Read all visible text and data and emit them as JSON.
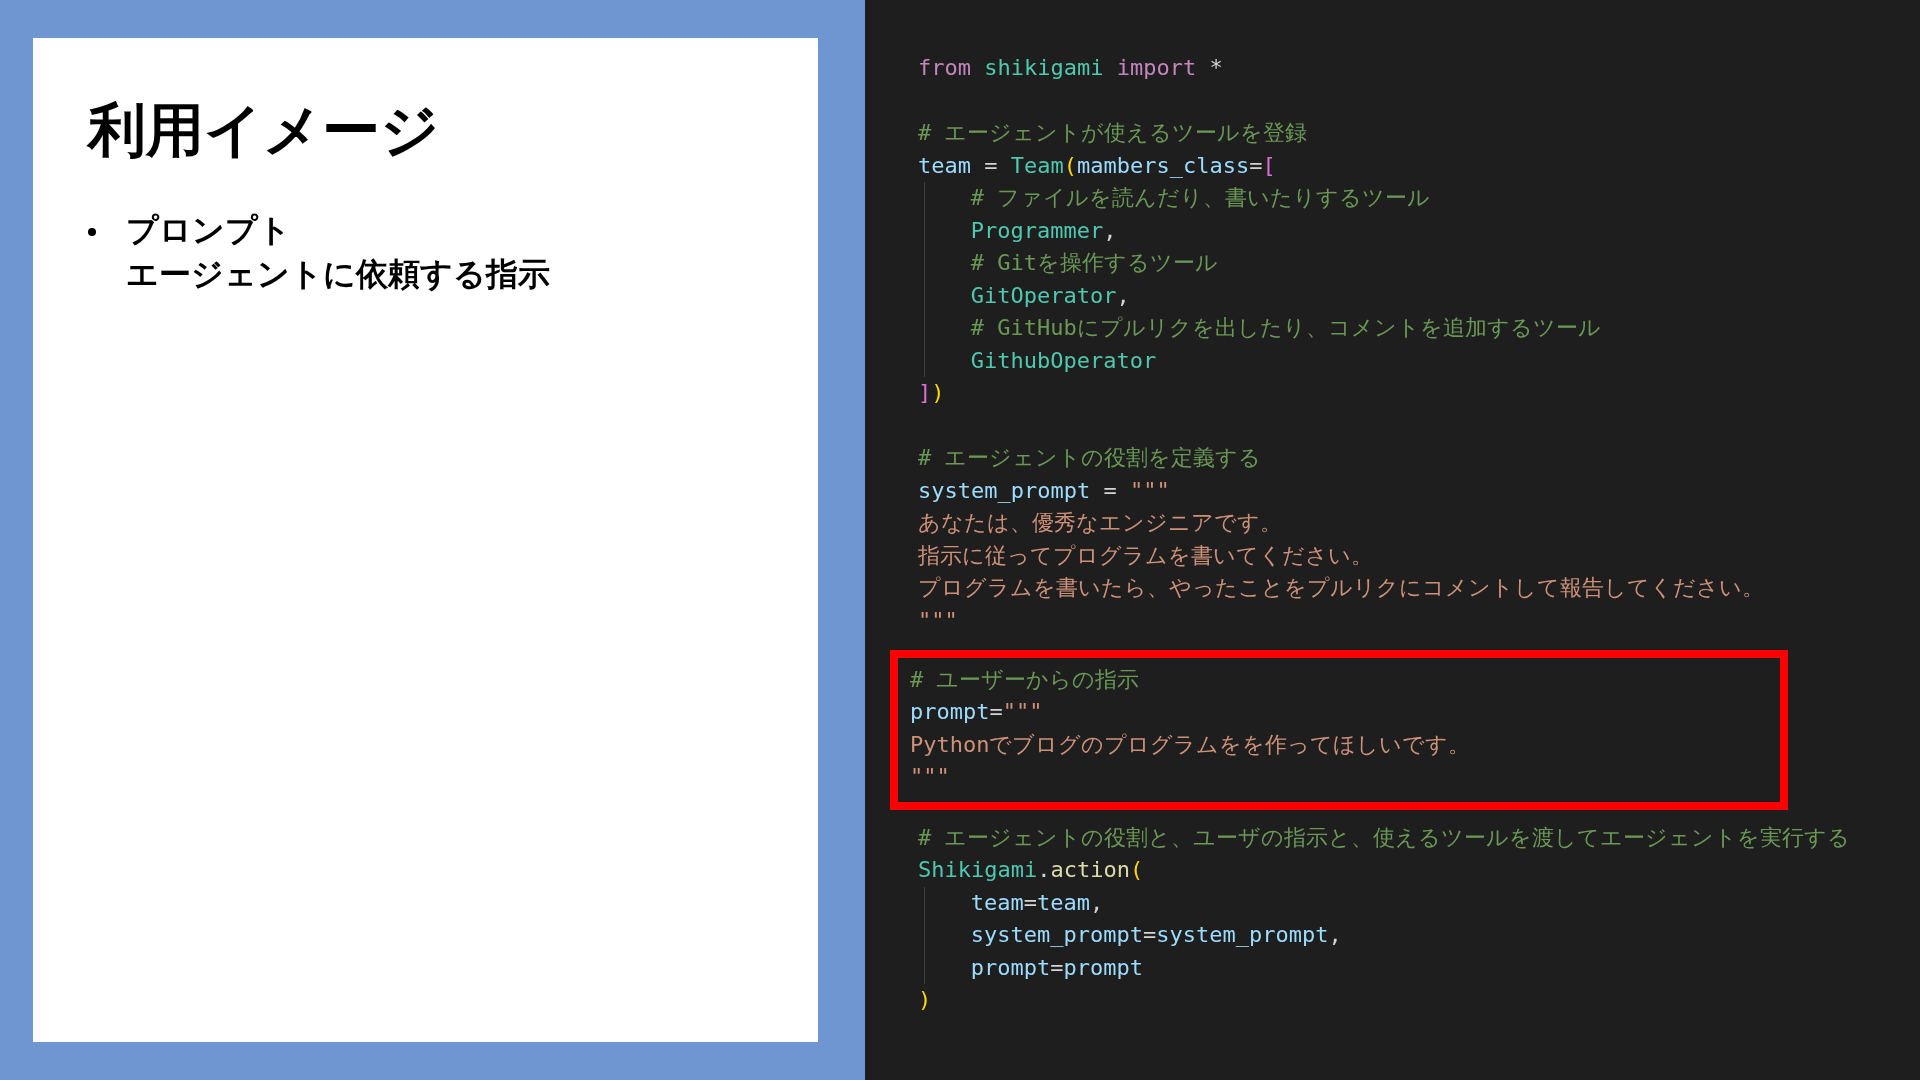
{
  "slide": {
    "title": "利用イメージ",
    "bullets": [
      {
        "lines": [
          "プロンプト",
          "エージェントに依頼する指示"
        ]
      }
    ]
  },
  "code": {
    "blocks": [
      {
        "highlighted": false,
        "lines": [
          {
            "indent": false,
            "tokens": [
              {
                "text": "from",
                "kind": "keyword"
              },
              {
                "text": " shikigami ",
                "kind": "module"
              },
              {
                "text": "import",
                "kind": "keyword"
              },
              {
                "text": " *",
                "kind": "plain"
              }
            ]
          }
        ]
      },
      {
        "highlighted": false,
        "lines": [
          {
            "indent": false,
            "tokens": [
              {
                "text": "# エージェントが使えるツールを登録",
                "kind": "comment"
              }
            ]
          },
          {
            "indent": false,
            "tokens": [
              {
                "text": "team",
                "kind": "variable"
              },
              {
                "text": " = ",
                "kind": "plain"
              },
              {
                "text": "Team",
                "kind": "class"
              },
              {
                "text": "(",
                "kind": "bracket-gold"
              },
              {
                "text": "mambers_class",
                "kind": "variable"
              },
              {
                "text": "=",
                "kind": "plain"
              },
              {
                "text": "[",
                "kind": "bracket-pink"
              }
            ]
          },
          {
            "indent": true,
            "tokens": [
              {
                "text": "# ファイルを読んだり、書いたりするツール",
                "kind": "comment"
              }
            ]
          },
          {
            "indent": true,
            "tokens": [
              {
                "text": "Programmer",
                "kind": "class"
              },
              {
                "text": ",",
                "kind": "plain"
              }
            ]
          },
          {
            "indent": true,
            "tokens": [
              {
                "text": "# Gitを操作するツール",
                "kind": "comment"
              }
            ]
          },
          {
            "indent": true,
            "tokens": [
              {
                "text": "GitOperator",
                "kind": "class"
              },
              {
                "text": ",",
                "kind": "plain"
              }
            ]
          },
          {
            "indent": true,
            "tokens": [
              {
                "text": "# GitHubにプルリクを出したり、コメントを追加するツール",
                "kind": "comment"
              }
            ]
          },
          {
            "indent": true,
            "tokens": [
              {
                "text": "GithubOperator",
                "kind": "class"
              }
            ]
          },
          {
            "indent": false,
            "tokens": [
              {
                "text": "]",
                "kind": "bracket-pink"
              },
              {
                "text": ")",
                "kind": "bracket-gold"
              }
            ]
          }
        ]
      },
      {
        "highlighted": false,
        "lines": [
          {
            "indent": false,
            "tokens": [
              {
                "text": "# エージェントの役割を定義する",
                "kind": "comment"
              }
            ]
          },
          {
            "indent": false,
            "tokens": [
              {
                "text": "system_prompt",
                "kind": "variable"
              },
              {
                "text": " = ",
                "kind": "plain"
              },
              {
                "text": "\"\"\"",
                "kind": "string"
              }
            ]
          },
          {
            "indent": false,
            "tokens": [
              {
                "text": "あなたは、優秀なエンジニアです。",
                "kind": "string"
              }
            ]
          },
          {
            "indent": false,
            "tokens": [
              {
                "text": "指示に従ってプログラムを書いてください。",
                "kind": "string"
              }
            ]
          },
          {
            "indent": false,
            "tokens": [
              {
                "text": "プログラムを書いたら、やったことをプルリクにコメントして報告してください。",
                "kind": "string"
              }
            ]
          },
          {
            "indent": false,
            "tokens": [
              {
                "text": "\"\"\"",
                "kind": "string"
              }
            ]
          }
        ]
      },
      {
        "highlighted": true,
        "lines": [
          {
            "indent": false,
            "tokens": [
              {
                "text": "# ユーザーからの指示",
                "kind": "comment"
              }
            ]
          },
          {
            "indent": false,
            "tokens": [
              {
                "text": "prompt",
                "kind": "variable"
              },
              {
                "text": "=",
                "kind": "plain"
              },
              {
                "text": "\"\"\"",
                "kind": "string"
              }
            ]
          },
          {
            "indent": false,
            "tokens": [
              {
                "text": "Pythonでブログのプログラムをを作ってほしいです。",
                "kind": "string"
              }
            ]
          },
          {
            "indent": false,
            "tokens": [
              {
                "text": "\"\"\"",
                "kind": "string"
              }
            ]
          }
        ]
      },
      {
        "highlighted": false,
        "lines": [
          {
            "indent": false,
            "tokens": [
              {
                "text": "# エージェントの役割と、ユーザの指示と、使えるツールを渡してエージェントを実行する",
                "kind": "comment"
              }
            ]
          },
          {
            "indent": false,
            "tokens": [
              {
                "text": "Shikigami",
                "kind": "class"
              },
              {
                "text": ".",
                "kind": "plain"
              },
              {
                "text": "action",
                "kind": "function"
              },
              {
                "text": "(",
                "kind": "bracket-gold"
              }
            ]
          },
          {
            "indent": true,
            "tokens": [
              {
                "text": "team",
                "kind": "variable"
              },
              {
                "text": "=",
                "kind": "plain"
              },
              {
                "text": "team",
                "kind": "variable"
              },
              {
                "text": ",",
                "kind": "plain"
              }
            ]
          },
          {
            "indent": true,
            "tokens": [
              {
                "text": "system_prompt",
                "kind": "variable"
              },
              {
                "text": "=",
                "kind": "plain"
              },
              {
                "text": "system_prompt",
                "kind": "variable"
              },
              {
                "text": ",",
                "kind": "plain"
              }
            ]
          },
          {
            "indent": true,
            "tokens": [
              {
                "text": "prompt",
                "kind": "variable"
              },
              {
                "text": "=",
                "kind": "plain"
              },
              {
                "text": "prompt",
                "kind": "variable"
              }
            ]
          },
          {
            "indent": false,
            "tokens": [
              {
                "text": ")",
                "kind": "bracket-gold"
              }
            ]
          }
        ]
      }
    ]
  }
}
